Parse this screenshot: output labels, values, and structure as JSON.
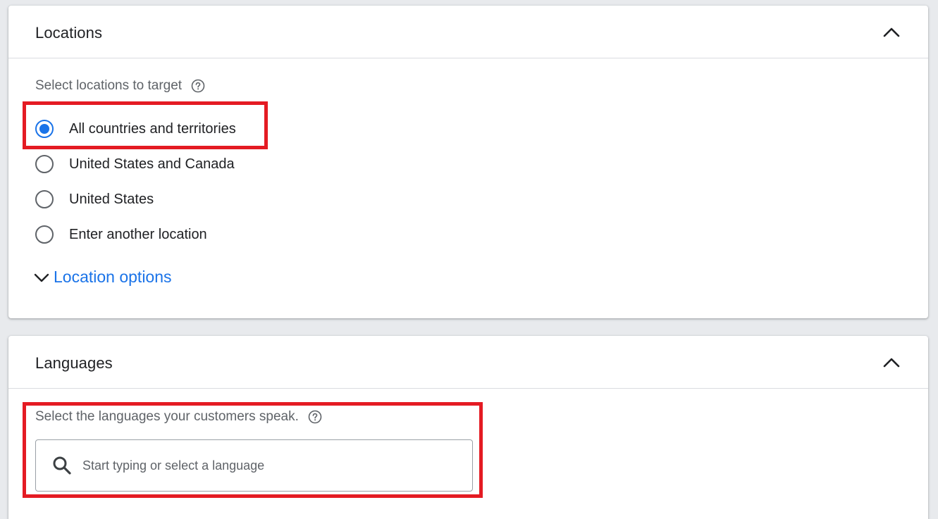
{
  "colors": {
    "accent": "#1a73e8",
    "highlight": "#e41b23",
    "background": "#e8eaed"
  },
  "locations": {
    "title": "Locations",
    "collapse_icon": "chevron-up-icon",
    "prompt": "Select locations to target",
    "help_icon": "help-circle-icon",
    "options": [
      {
        "label": "All countries and territories",
        "selected": true
      },
      {
        "label": "United States and Canada",
        "selected": false
      },
      {
        "label": "United States",
        "selected": false
      },
      {
        "label": "Enter another location",
        "selected": false
      }
    ],
    "more_options_label": "Location options",
    "more_options_icon": "chevron-down-icon"
  },
  "languages": {
    "title": "Languages",
    "collapse_icon": "chevron-up-icon",
    "prompt": "Select the languages your customers speak.",
    "help_icon": "help-circle-icon",
    "search": {
      "placeholder": "Start typing or select a language",
      "value": "",
      "icon": "search-icon"
    }
  }
}
